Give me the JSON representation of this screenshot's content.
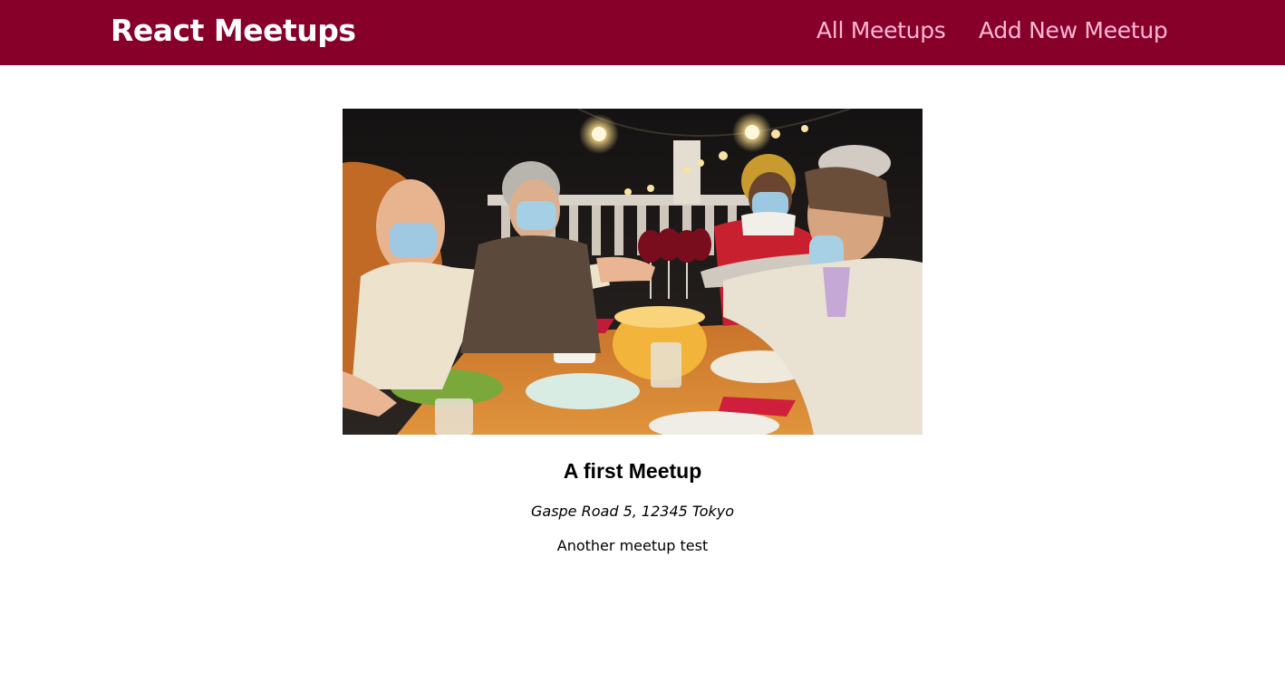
{
  "header": {
    "logo": "React Meetups",
    "nav": [
      {
        "label": "All Meetups"
      },
      {
        "label": "Add New Meetup"
      }
    ]
  },
  "meetup": {
    "image_alt": "A first Meetup",
    "title": "A first Meetup",
    "address": "Gaspe Road 5, 12345 Tokyo",
    "description": "Another meetup test"
  },
  "colors": {
    "header_bg": "#86002a",
    "nav_link": "#fcb8d2",
    "logo": "#ffffff"
  }
}
